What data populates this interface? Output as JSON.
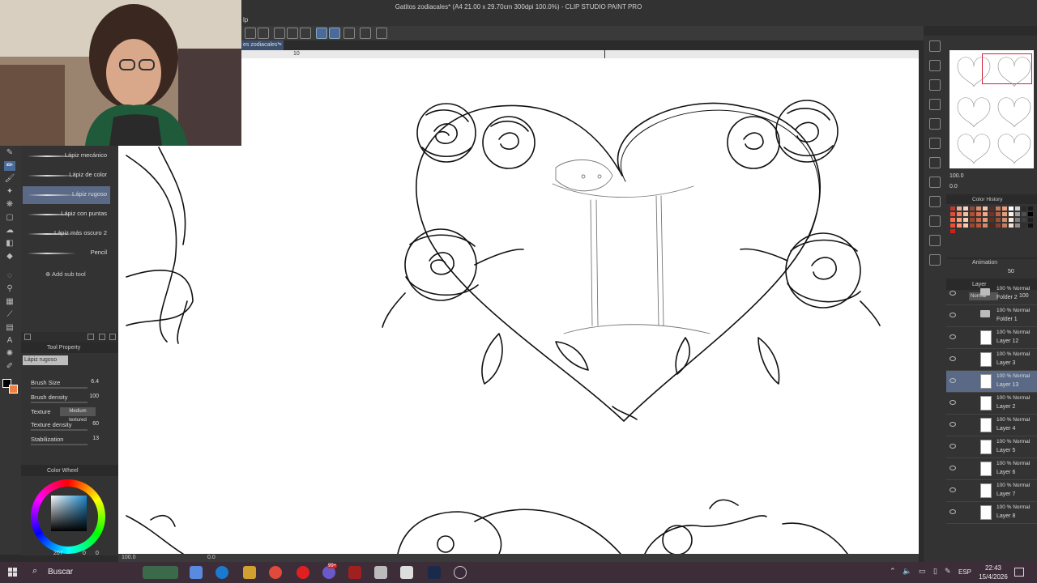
{
  "window": {
    "title": "Gatitos zodiacales* (A4 21.00 x 29.70cm 300dpi 100.0%) - CLIP STUDIO PAINT PRO",
    "menu_visible_fragment": "lp",
    "tab_label": "es zodiacales*",
    "ruler_mark": "10"
  },
  "subtool": {
    "brushes": [
      {
        "label": "Lápiz mecánico"
      },
      {
        "label": "Lápiz de color"
      },
      {
        "label": "Lápiz rugoso",
        "selected": true
      },
      {
        "label": "Lápiz con puntas"
      },
      {
        "label": "Lápiz más oscuro 2"
      },
      {
        "label": "Pencil"
      }
    ],
    "add_sub_tool": "Add sub tool"
  },
  "tool_property": {
    "header": "Tool Property",
    "tool_name": "Lápiz rugoso",
    "brush_size_label": "Brush Size",
    "brush_size_value": "6.4",
    "brush_density_label": "Brush density",
    "brush_density_value": "100",
    "texture_label": "Texture",
    "texture_value": "Medium textured",
    "texture_density_label": "Texture density",
    "texture_density_value": "60",
    "stabilization_label": "Stabilization",
    "stabilization_value": "13"
  },
  "color_wheel": {
    "header": "Color Wheel",
    "readout": "207",
    "readout2": "0",
    "readout3": "0"
  },
  "canvas": {
    "zoom_readout": "100.0",
    "angle_readout": "0.0"
  },
  "navigator": {
    "zoom": "100.0",
    "angle": "0.0"
  },
  "color_history": {
    "header": "Color History",
    "swatches": [
      "#c0392b",
      "#e6b0a0",
      "#f5d5c8",
      "#8b4a3a",
      "#d98c6e",
      "#f0c8b0",
      "#5a2c22",
      "#c47a5e",
      "#e8a080",
      "#ffffff",
      "#d0d0d0",
      "#2a2a2a",
      "#1a1a1a",
      "#e04e3a",
      "#f08060",
      "#f5c0a0",
      "#b05030",
      "#d67050",
      "#f0a888",
      "#7a3020",
      "#b86040",
      "#e0a080",
      "#fff0e8",
      "#a0a0a0",
      "#505050",
      "#000000",
      "#ff6a4a",
      "#ffa080",
      "#f8d0b8",
      "#a84028",
      "#c86848",
      "#e89878",
      "#603020",
      "#985038",
      "#d09070",
      "#ffe8d8",
      "#808080",
      "#404040",
      "#202020",
      "#f05030",
      "#ff9070",
      "#ffc8a8",
      "#984830",
      "#b85838",
      "#d88868",
      "#502818",
      "#884030",
      "#c08060",
      "#f8e0d0",
      "#909090",
      "#303030",
      "#101010",
      "#d02018"
    ],
    "last_used": [
      "#ff2a2a",
      "#2a6aff",
      "#30c040"
    ]
  },
  "animation": {
    "header": "Animation",
    "opacity": "50"
  },
  "layers": {
    "header": "Layer",
    "blend_mode": "Normal",
    "opacity": "100",
    "items": [
      {
        "blend": "100 % Normal",
        "name": "Folder 2",
        "type": "folder"
      },
      {
        "blend": "100 % Normal",
        "name": "Folder 1",
        "type": "folder"
      },
      {
        "blend": "100 % Normal",
        "name": "Layer 12",
        "type": "layer"
      },
      {
        "blend": "100 % Normal",
        "name": "Layer 3",
        "type": "layer"
      },
      {
        "blend": "100 % Normal",
        "name": "Layer 13",
        "type": "layer",
        "selected": true
      },
      {
        "blend": "100 % Normal",
        "name": "Layer 2",
        "type": "layer"
      },
      {
        "blend": "100 % Normal",
        "name": "Layer 4",
        "type": "layer"
      },
      {
        "blend": "100 % Normal",
        "name": "Layer 5",
        "type": "layer"
      },
      {
        "blend": "100 % Normal",
        "name": "Layer 6",
        "type": "layer"
      },
      {
        "blend": "100 % Normal",
        "name": "Layer 7",
        "type": "layer"
      },
      {
        "blend": "100 % Normal",
        "name": "Layer 8",
        "type": "layer"
      }
    ]
  },
  "taskbar": {
    "search_label": "Buscar",
    "language": "ESP",
    "time": "22:43",
    "date": "15/4/2026",
    "badge": "99+"
  },
  "colors": {
    "accent": "#5a6a86",
    "active_tool": "#4a6a9a",
    "navigator_frame": "#d6203d",
    "taskbar": "#3c2d38"
  }
}
